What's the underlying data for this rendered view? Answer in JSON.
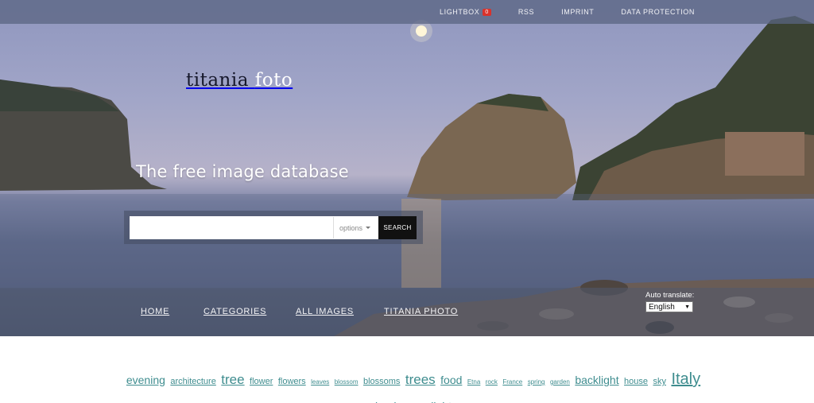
{
  "topnav": {
    "lightbox_label": "LIGHTBOX",
    "lightbox_count": "0",
    "rss_label": "RSS",
    "imprint_label": "IMPRINT",
    "data_protection_label": "DATA PROTECTION"
  },
  "logo": {
    "part1": "titania",
    "part2": "foto"
  },
  "tagline": "The free image database",
  "search": {
    "placeholder": "",
    "options_label": "options",
    "button_label": "SEARCH"
  },
  "mainnav": {
    "home": "HOME",
    "categories": "CATEGORIES",
    "all_images": "ALL IMAGES",
    "titania_photo": "TITANIA PHOTO"
  },
  "translate": {
    "label": "Auto translate:",
    "selected": "English"
  },
  "tags": [
    {
      "text": "evening",
      "size": 3
    },
    {
      "text": "architecture",
      "size": 2
    },
    {
      "text": "tree",
      "size": 4
    },
    {
      "text": "flower",
      "size": 2
    },
    {
      "text": "flowers",
      "size": 2
    },
    {
      "text": "leaves",
      "size": 1
    },
    {
      "text": "blossom",
      "size": 1
    },
    {
      "text": "blossoms",
      "size": 2
    },
    {
      "text": "trees",
      "size": 4
    },
    {
      "text": "food",
      "size": 3
    },
    {
      "text": "Etna",
      "size": 1
    },
    {
      "text": "rock",
      "size": 1
    },
    {
      "text": "France",
      "size": 1
    },
    {
      "text": "spring",
      "size": 1
    },
    {
      "text": "garden",
      "size": 1
    },
    {
      "text": "backlight",
      "size": 3
    },
    {
      "text": "house",
      "size": 2
    },
    {
      "text": "sky",
      "size": 2
    },
    {
      "text": "Italy",
      "size": 5
    },
    {
      "text": "landscape",
      "size": 3
    },
    {
      "text": "light",
      "size": 3
    }
  ],
  "colors": {
    "tag_link": "#3f8d8f",
    "badge": "#d9322b",
    "search_button": "#111111"
  }
}
